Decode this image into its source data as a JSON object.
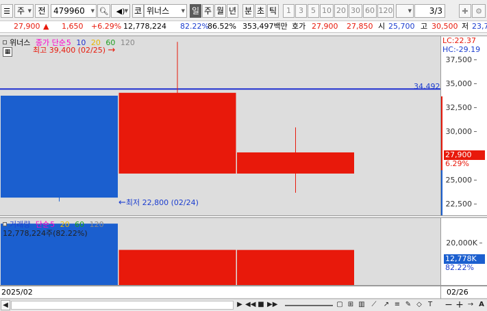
{
  "toolbar": {
    "market_type": "주",
    "prev_label": "전",
    "code": "479960",
    "market_label": "코",
    "stock_name": "위너스",
    "periods": [
      "일",
      "주",
      "월",
      "년",
      "분",
      "초",
      "틱"
    ],
    "selected_period": "일",
    "intervals": [
      "1",
      "3",
      "5",
      "10",
      "20",
      "30",
      "60",
      "120"
    ],
    "page": "3/3"
  },
  "quote": {
    "price": "27,900",
    "change_arrow": "▲",
    "change": "1,650",
    "change_pct": "+6.29%",
    "volume": "12,778,224",
    "volume_ratio": "82.22%",
    "turnover_ratio": "86.52%",
    "amount": "353,497백만",
    "quote_label": "호가",
    "ask": "27,900",
    "bid": "27,850",
    "open_label": "시",
    "open": "25,700",
    "high_label": "고",
    "high": "30,500",
    "low_label": "저",
    "low": "23,7"
  },
  "price_pane": {
    "legend": {
      "name": "위너스",
      "ma_label": "종가 단순",
      "ma_periods": [
        "5",
        "10",
        "20",
        "60",
        "120"
      ]
    },
    "high_note": "최고 39,400 (02/25)",
    "low_note": "최저 22,800 (02/24)",
    "lc": "LC:22.37",
    "hc": "HC:-29.19",
    "ticks": [
      "37,500",
      "35,000",
      "32,500",
      "30,000",
      "27,500",
      "25,000",
      "22,500"
    ],
    "hline_label": "34,492",
    "current_price": "27,900",
    "current_pct": "6.29%"
  },
  "volume_pane": {
    "legend": {
      "name": "거래량",
      "ma_label": "단순",
      "ma_periods": [
        "5",
        "20",
        "60",
        "120"
      ]
    },
    "value_label": "12,778,224주(82.22%)",
    "tick": "20,000K",
    "current_volume": "12,778K",
    "current_pct": "82.22%"
  },
  "date_bar": {
    "start": "2025/02",
    "end": "02/26"
  },
  "colors": {
    "up": "#e8190b",
    "down": "#1b5fcf",
    "hline": "#1f2fd0",
    "ma5": "#ff00cc",
    "ma10": "#1f2fd0",
    "ma20": "#e8b800",
    "ma60": "#1e9e1e",
    "ma120": "#888888"
  },
  "chart_data": [
    {
      "type": "candlestick",
      "categories": [
        "02/24",
        "02/25",
        "02/26"
      ],
      "open": [
        33800,
        25700,
        25700
      ],
      "high": [
        33800,
        39400,
        30500
      ],
      "low": [
        22800,
        25700,
        23700
      ],
      "close": [
        23200,
        34100,
        27900
      ],
      "hline": 34492,
      "ylim": [
        21500,
        39700
      ]
    },
    {
      "type": "bar",
      "categories": [
        "02/24",
        "02/25",
        "02/26"
      ],
      "values": [
        22000000,
        12800000,
        12778224
      ],
      "ylim": [
        0,
        23000000
      ]
    }
  ]
}
